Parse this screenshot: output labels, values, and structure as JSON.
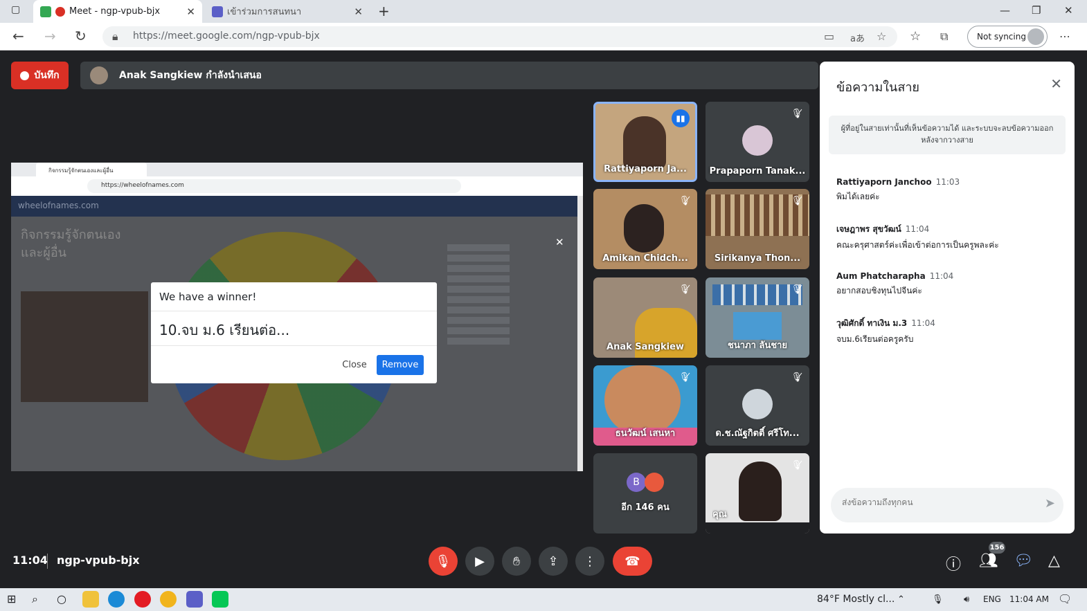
{
  "browser": {
    "tabs": [
      {
        "title": "Meet - ngp-vpub-bjx",
        "close": "✕"
      },
      {
        "title": "เข้าร่วมการสนทนา",
        "close": "✕"
      }
    ],
    "new_tab": "+",
    "url": "https://meet.google.com/ngp-vpub-bjx",
    "profile_label": "Not syncing",
    "window_controls": [
      "—",
      "❐",
      "✕"
    ]
  },
  "meet": {
    "record_label": "บันทึก",
    "presenting_text": "Anak Sangkiew กำลังนำเสนอ",
    "meeting_time": "11:04",
    "meeting_code": "ngp-vpub-bjx",
    "people_count": "156"
  },
  "shared_screen": {
    "browser_tab": "กิจกรรมรู้จักตนเองและผู้อื่น",
    "browser_url": "https://wheelofnames.com",
    "site_header": "wheelofnames.com",
    "page_title": "กิจกรรมรู้จักตนเอง และผู้อื่น",
    "dialog": {
      "heading": "We have a winner!",
      "winner": "10.จบ ม.6 เรียนต่อ...",
      "close_label": "Close",
      "remove_label": "Remove"
    }
  },
  "participants": [
    {
      "name": "Rattiyaporn Ja...",
      "speaking": true
    },
    {
      "name": "Prapaporn Tanak...",
      "muted": true
    },
    {
      "name": "Amikan Chidch...",
      "muted": true
    },
    {
      "name": "Sirikanya Thon...",
      "muted": true
    },
    {
      "name": "Anak Sangkiew",
      "muted": true
    },
    {
      "name": "ชนาภา ลันชาย",
      "muted": true
    },
    {
      "name": "ธนวัฒน์ เสนหา",
      "muted": true
    },
    {
      "name": "ด.ช.ณัฐกิตติ์ ศรีโท...",
      "muted": true
    },
    {
      "name": "อีก 146 คน",
      "avatar_letter": "B"
    },
    {
      "name": "คุณ",
      "muted": true
    }
  ],
  "chat": {
    "title": "ข้อความในสาย",
    "notice": "ผู้ที่อยู่ในสายเท่านั้นที่เห็นข้อความได้ และระบบจะลบข้อความออกหลังจากวางสาย",
    "messages": [
      {
        "sender": "Rattiyaporn Janchoo",
        "time": "11:03",
        "text": "พิมได้เลยค่ะ"
      },
      {
        "sender": "เจษฎาพร สุขวัฒน์",
        "time": "11:04",
        "text": "คณะครุศาสตร์ค่ะเพื่อเข้าต่อการเป็นครูพละค่ะ"
      },
      {
        "sender": "Aum Phatcharapha",
        "time": "11:04",
        "text": "อยากสอบชิงทุนไปจีนค่ะ"
      },
      {
        "sender": "วุฒิศักดิ์ ทาเงิน ม.3",
        "time": "11:04",
        "text": "จบม.6เรียนต่อครูครับ"
      }
    ],
    "input_placeholder": "ส่งข้อความถึงทุกคน"
  },
  "taskbar": {
    "weather": "84°F  Mostly cl...",
    "language": "ENG",
    "clock": "11:04 AM"
  },
  "colors": {
    "meet_bg": "#202124",
    "record_red": "#d93025",
    "accent_blue": "#1a73e8",
    "tile_bg": "#3c4043"
  }
}
